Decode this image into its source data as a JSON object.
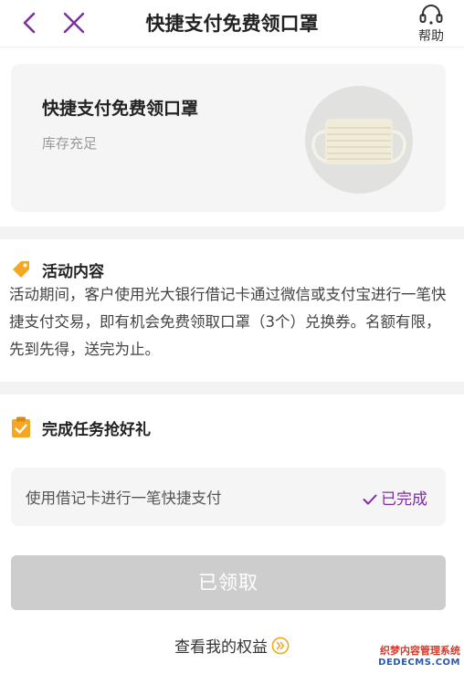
{
  "header": {
    "title": "快捷支付免费领口罩",
    "help_label": "帮助"
  },
  "product": {
    "name": "快捷支付免费领口罩",
    "stock_status": "库存充足",
    "image_icon": "face-mask-image"
  },
  "activity": {
    "section_title": "活动内容",
    "description": "活动期间，客户使用光大银行借记卡通过微信或支付宝进行一笔快捷支付交易，即有机会免费领取口罩（3个）兑换券。名额有限，先到先得，送完为止。"
  },
  "tasks": {
    "section_title": "完成任务抢好礼",
    "items": [
      {
        "label": "使用借记卡进行一笔快捷支付",
        "status": "已完成"
      }
    ]
  },
  "actions": {
    "claim_button": "已领取",
    "view_benefits": "查看我的权益"
  },
  "watermark": {
    "line1": "织梦内容管理系统",
    "line2": "DEDECMS.COM"
  },
  "colors": {
    "accent_purple": "#7b2f9e",
    "tag_orange": "#f5a623",
    "button_disabled": "#cdcdcd",
    "card_bg": "#f5f5f5"
  }
}
